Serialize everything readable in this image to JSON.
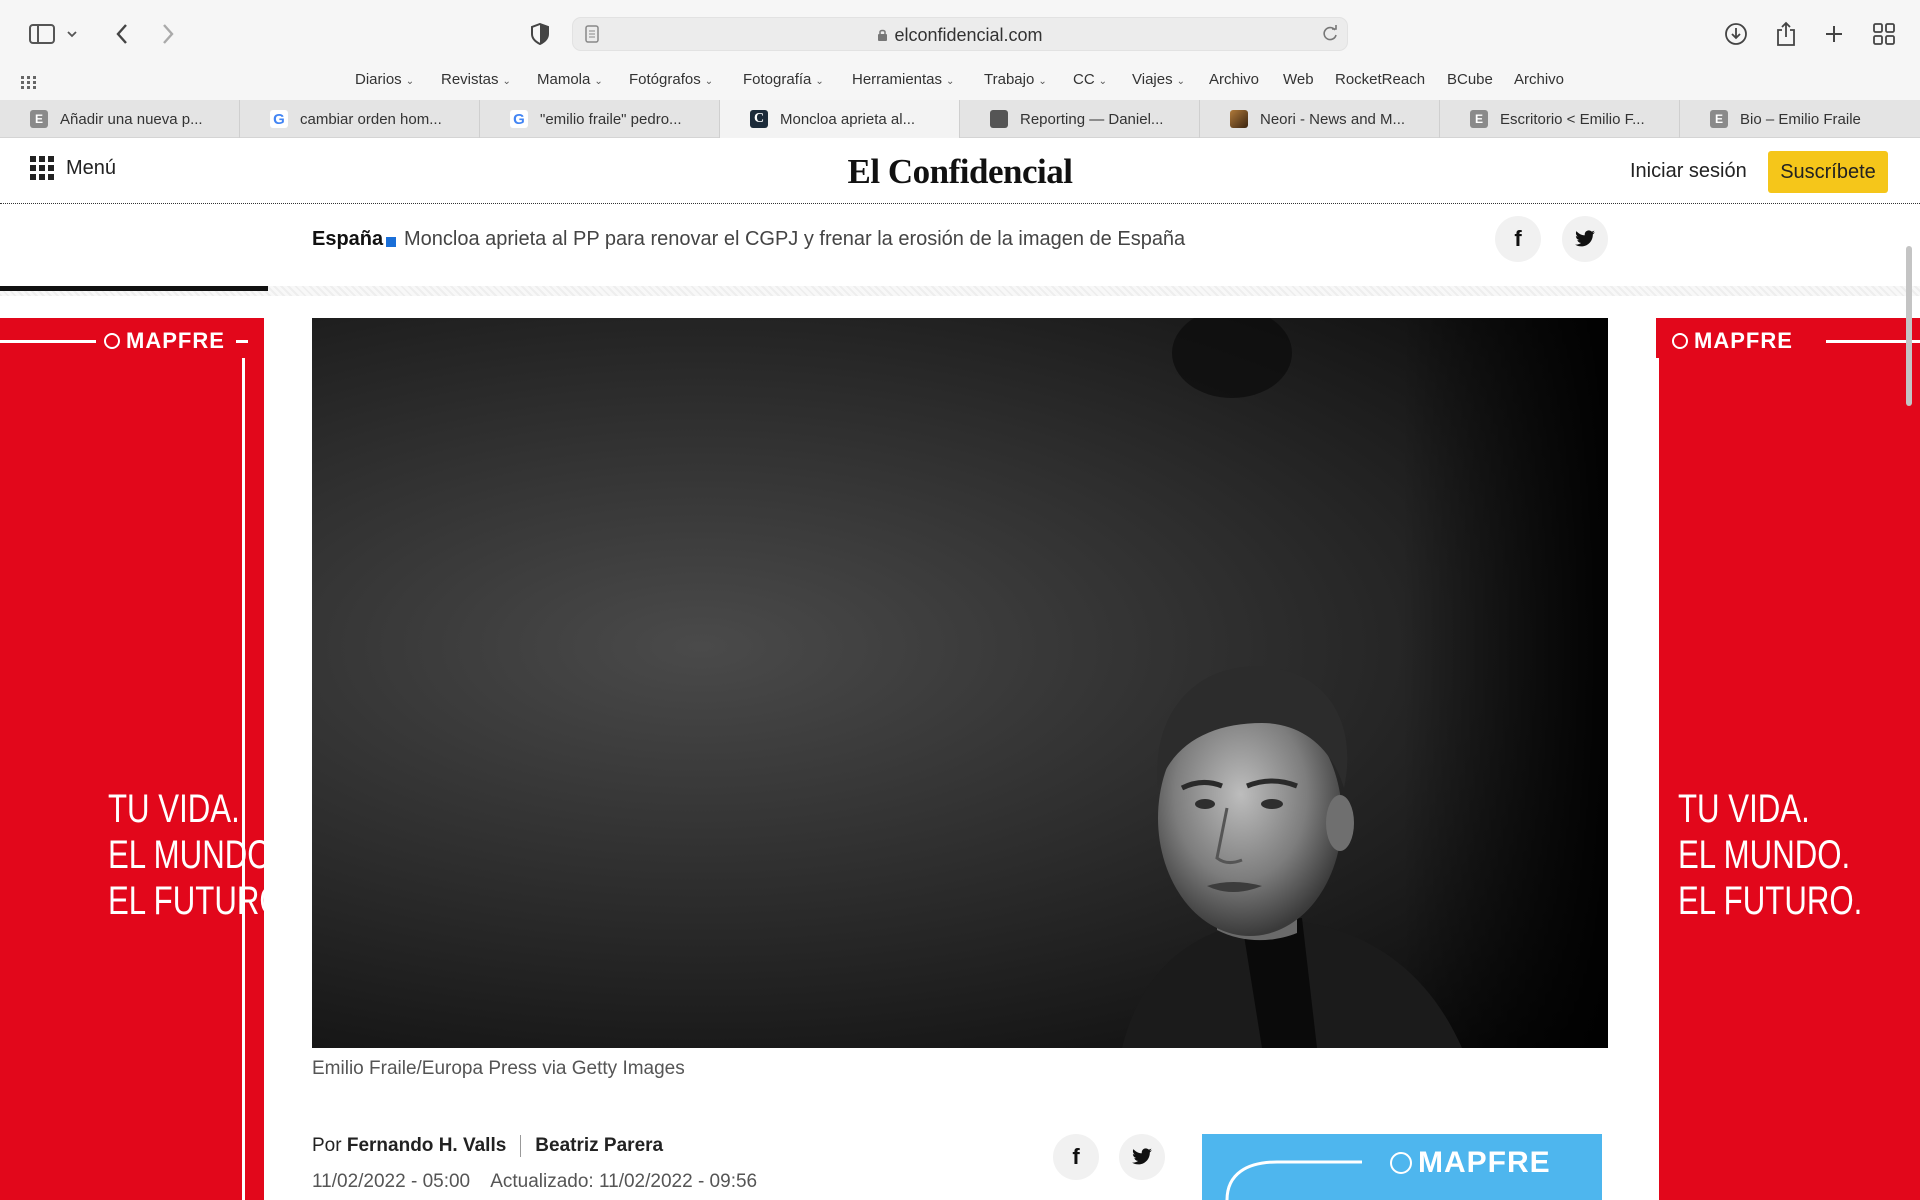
{
  "browser": {
    "url": "elconfidencial.com",
    "bookmarks": [
      "Diarios",
      "Revistas",
      "Mamola",
      "Fotógrafos",
      "Fotografía",
      "Herramientas",
      "Trabajo",
      "CC",
      "Viajes",
      "Archivo",
      "Web",
      "RocketReach",
      "BCube",
      "Archivo"
    ],
    "tabs": [
      {
        "label": "Añadir una nueva p...",
        "icon": "E"
      },
      {
        "label": "cambiar orden hom...",
        "icon": "G"
      },
      {
        "label": "\"emilio fraile\" pedro...",
        "icon": "G"
      },
      {
        "label": "Moncloa aprieta al...",
        "icon": "C"
      },
      {
        "label": "Reporting — Daniel...",
        "icon": "cube"
      },
      {
        "label": "Neori - News and M...",
        "icon": "img"
      },
      {
        "label": "Escritorio < Emilio F...",
        "icon": "E"
      },
      {
        "label": "Bio – Emilio Fraile",
        "icon": "E"
      }
    ]
  },
  "site": {
    "menu_label": "Menú",
    "logo": "El Confidencial",
    "login": "Iniciar sesión",
    "subscribe": "Suscríbete"
  },
  "subnav": {
    "section": "España",
    "headline": "Moncloa aprieta al PP para renovar el CGPJ y frenar la erosión de la imagen de España"
  },
  "ads": {
    "brand": "MAPFRE",
    "slogan": [
      "TU VIDA.",
      "EL MUNDO.",
      "EL FUTURO."
    ]
  },
  "article": {
    "caption": "Emilio Fraile/Europa Press via Getty Images",
    "by_prefix": "Por",
    "author1": "Fernando H. Valls",
    "author2": "Beatriz Parera",
    "published": "11/02/2022 - 05:00",
    "updated": "Actualizado: 11/02/2022 - 09:56"
  },
  "colors": {
    "subscribe": "#f5c61a",
    "ad_red": "#e2071b",
    "section_square": "#1a6fd8",
    "ad_blue": "#4eb6ee"
  }
}
